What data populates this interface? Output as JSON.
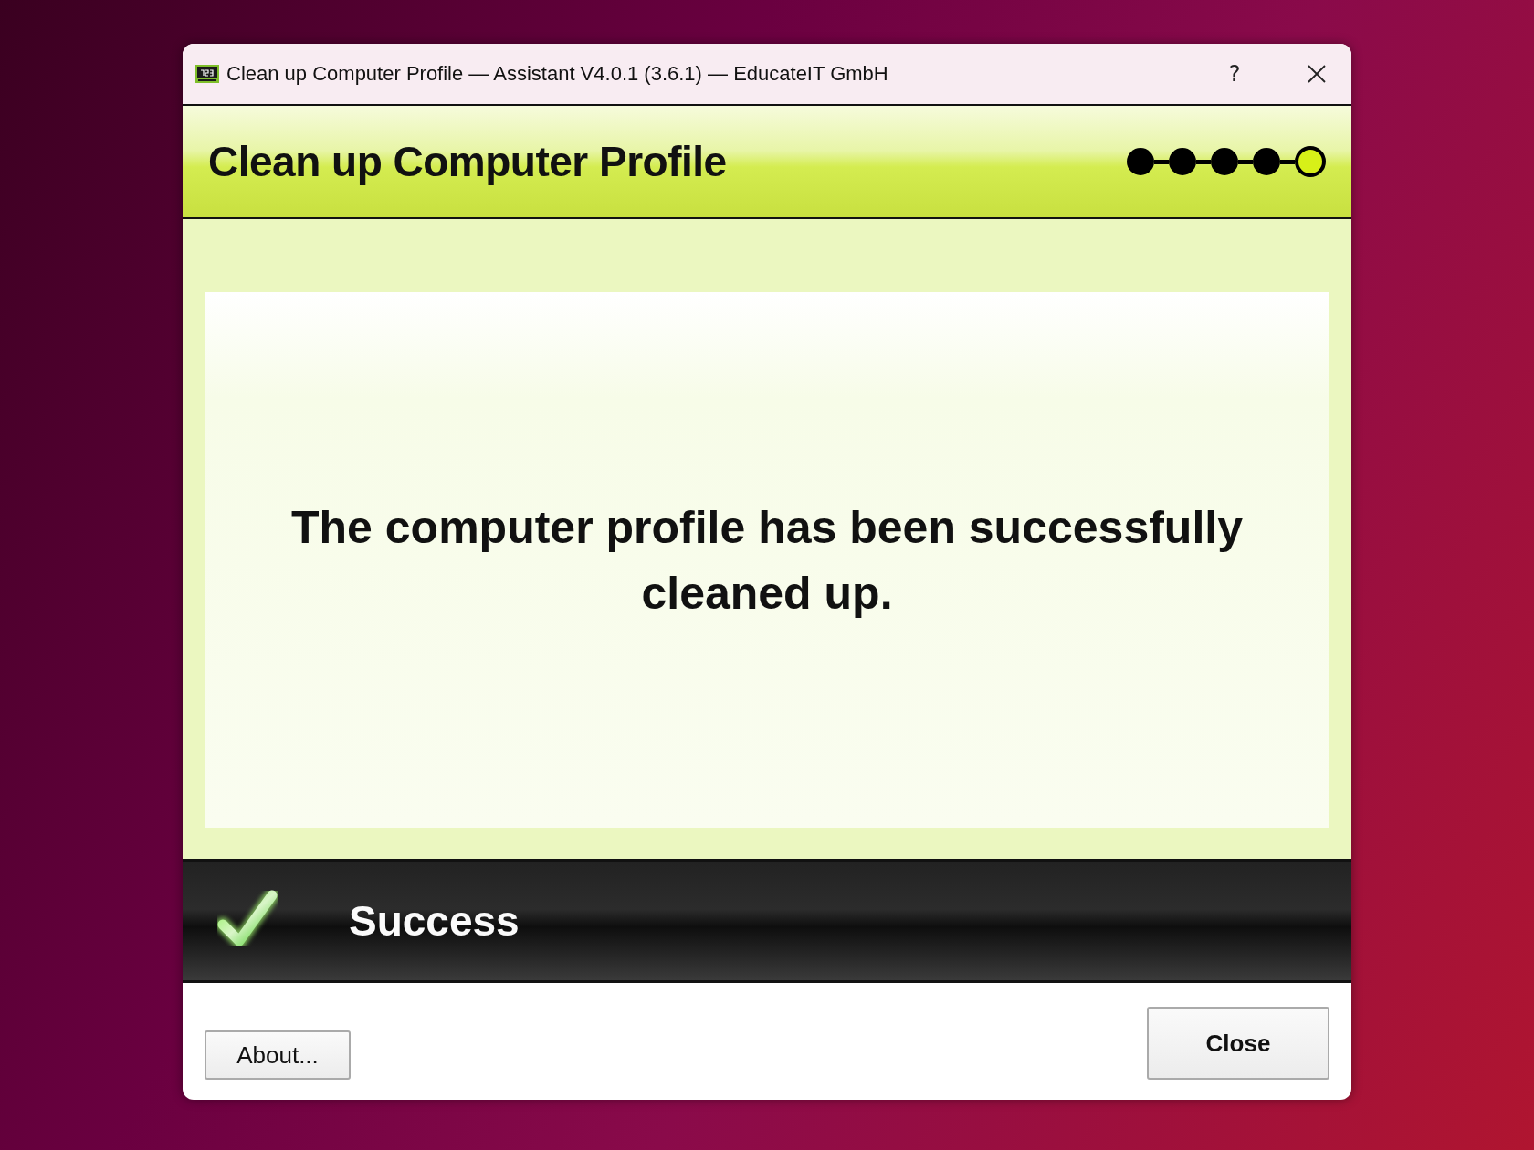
{
  "window": {
    "title": "Clean up Computer Profile — Assistant V4.0.1 (3.6.1) — EducateIT GmbH",
    "help": "?"
  },
  "header": {
    "title": "Clean up Computer Profile",
    "steps": [
      {
        "selected": false
      },
      {
        "selected": false
      },
      {
        "selected": false
      },
      {
        "selected": false
      },
      {
        "selected": true
      }
    ]
  },
  "message": "The computer profile has been successfully cleaned up.",
  "status": {
    "kind": "success",
    "label": "Success"
  },
  "buttons": [
    {
      "label": "About...",
      "kind": "secondary"
    },
    {
      "label": "Close",
      "kind": "primary"
    }
  ]
}
